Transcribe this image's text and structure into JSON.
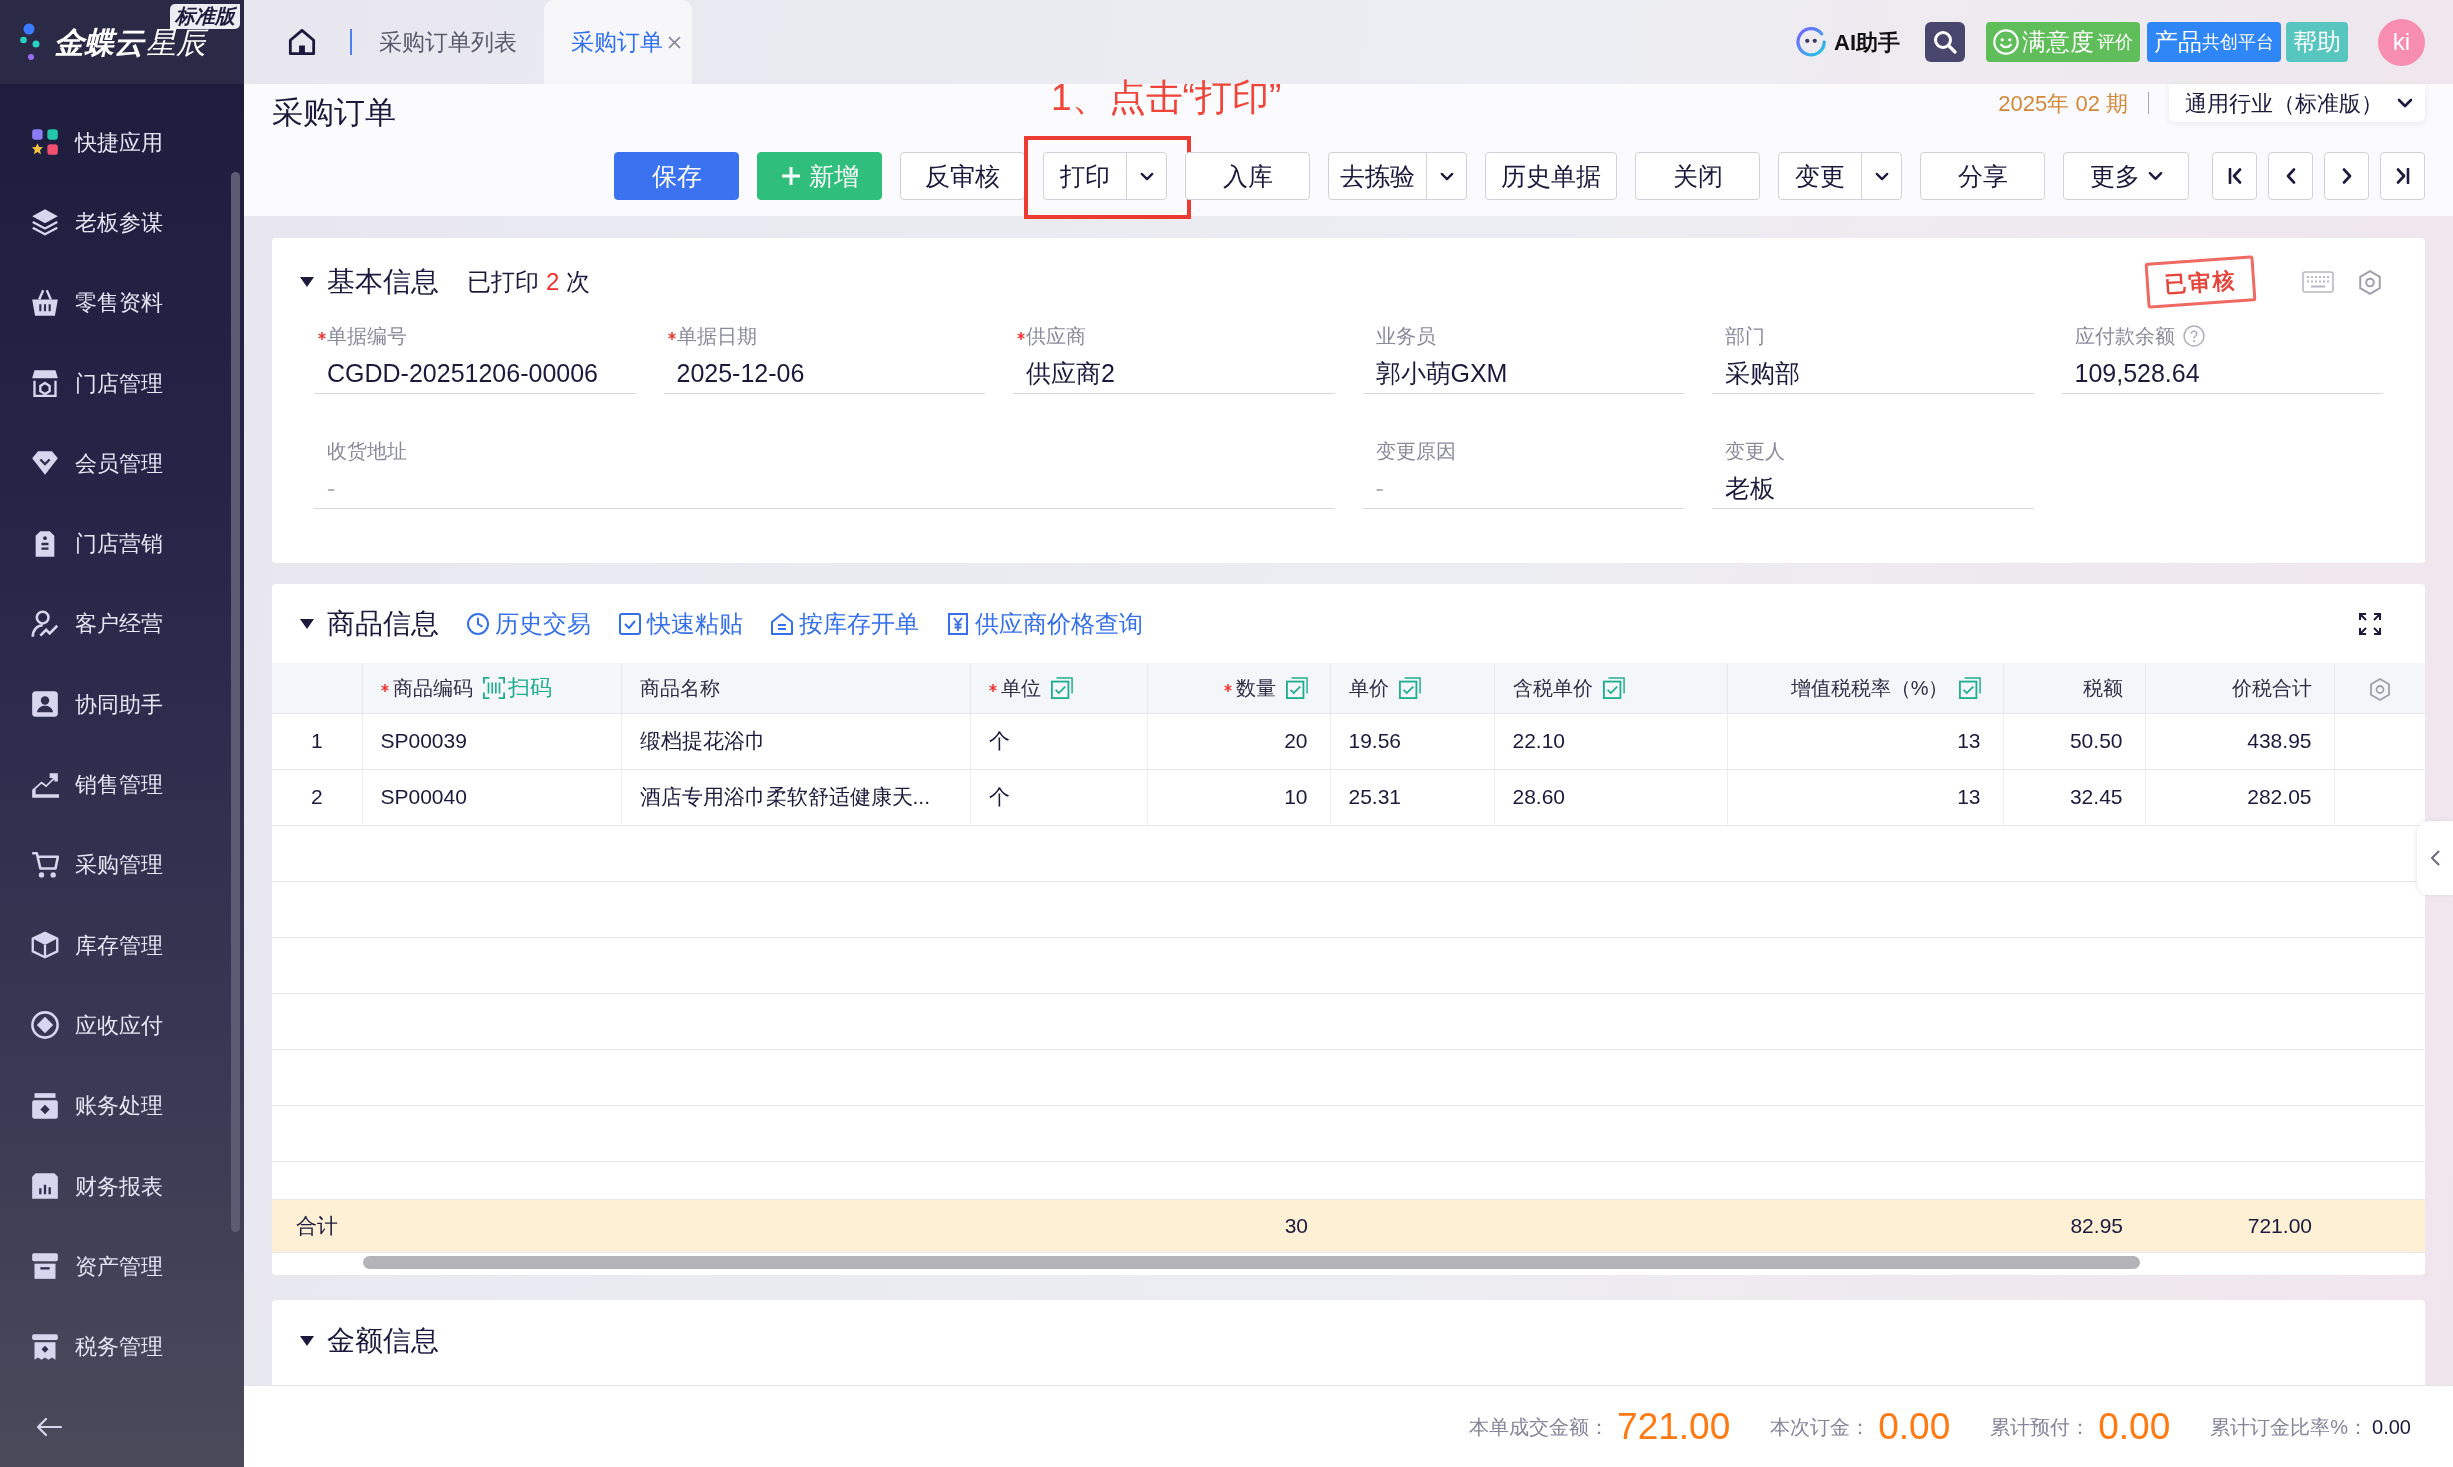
{
  "sidebar": {
    "logo": {
      "brand": "金蝶云",
      "product": "星辰",
      "edition": "标准版"
    },
    "items": [
      {
        "label": "快捷应用"
      },
      {
        "label": "老板参谋"
      },
      {
        "label": "零售资料"
      },
      {
        "label": "门店管理"
      },
      {
        "label": "会员管理"
      },
      {
        "label": "门店营销"
      },
      {
        "label": "客户经营"
      },
      {
        "label": "协同助手"
      },
      {
        "label": "销售管理"
      },
      {
        "label": "采购管理"
      },
      {
        "label": "库存管理"
      },
      {
        "label": "应收应付"
      },
      {
        "label": "账务处理"
      },
      {
        "label": "财务报表"
      },
      {
        "label": "资产管理"
      },
      {
        "label": "税务管理"
      }
    ]
  },
  "top_bar": {
    "tabs": [
      {
        "label": "采购订单列表",
        "selected": false,
        "closable": false
      },
      {
        "label": "采购订单",
        "selected": true,
        "closable": true
      }
    ],
    "ai_assistant": "AI助手",
    "satisfaction": {
      "label": "满意度",
      "suffix": "评价"
    },
    "co_creation": {
      "label": "产品",
      "suffix": "共创平台"
    },
    "help": "帮助",
    "avatar": "ki"
  },
  "page_header": {
    "title": "采购订单",
    "annotation": "1、点击“打印”",
    "period": "2025年 02 期",
    "industry": "通用行业（标准版）",
    "toolbar": [
      {
        "label": "保存",
        "kind": "primary",
        "highlighted": false
      },
      {
        "label": "新增",
        "kind": "add",
        "highlighted": false
      },
      {
        "label": "反审核",
        "kind": "plain",
        "highlighted": false
      },
      {
        "label": "打印",
        "kind": "split",
        "highlighted": true
      },
      {
        "label": "入库",
        "kind": "plain",
        "highlighted": false
      },
      {
        "label": "去拣验",
        "kind": "split",
        "highlighted": false
      },
      {
        "label": "历史单据",
        "kind": "plain",
        "highlighted": false
      },
      {
        "label": "关闭",
        "kind": "plain",
        "highlighted": false
      },
      {
        "label": "变更",
        "kind": "split",
        "highlighted": false
      },
      {
        "label": "分享",
        "kind": "plain",
        "highlighted": false
      },
      {
        "label": "更多",
        "kind": "menu",
        "highlighted": false
      }
    ],
    "pager": [
      {
        "kind": "first"
      },
      {
        "kind": "previous"
      },
      {
        "kind": "next"
      },
      {
        "kind": "last"
      }
    ]
  },
  "basic_info": {
    "title": "基本信息",
    "expanded": true,
    "print_status": {
      "prefix": "已打印",
      "count": "2",
      "suffix": "次"
    },
    "stamp": "已审核",
    "fields": [
      {
        "label": "单据编号",
        "kind": "normal",
        "required": true,
        "help": false,
        "value": "CGDD-20251206-00006"
      },
      {
        "label": "单据日期",
        "kind": "normal",
        "required": true,
        "help": false,
        "value": "2025-12-06"
      },
      {
        "label": "供应商",
        "kind": "normal",
        "required": true,
        "help": false,
        "value": "供应商2"
      },
      {
        "label": "业务员",
        "kind": "normal",
        "required": false,
        "help": false,
        "value": "郭小萌GXM"
      },
      {
        "label": "部门",
        "kind": "normal",
        "required": false,
        "help": false,
        "value": "采购部"
      },
      {
        "label": "应付款余额",
        "kind": "normal",
        "required": false,
        "help": true,
        "value": "109,528.64"
      },
      {
        "label": "收货地址",
        "kind": "wide",
        "required": false,
        "help": false,
        "placeholder": "-"
      },
      {
        "label": "变更原因",
        "kind": "normal",
        "required": false,
        "help": false,
        "placeholder": "-"
      },
      {
        "label": "变更人",
        "kind": "normal",
        "required": false,
        "help": false,
        "value": "老板"
      }
    ]
  },
  "products": {
    "title": "商品信息",
    "expanded": true,
    "actions": [
      {
        "label": "历史交易",
        "kind": "history"
      },
      {
        "label": "快速粘贴",
        "kind": "paste"
      },
      {
        "label": "按库存开单",
        "kind": "stock"
      },
      {
        "label": "供应商价格查询",
        "kind": "price"
      }
    ],
    "table": {
      "columns": [
        {
          "label": "商品编码",
          "kind": "code",
          "required": true,
          "batch_edit": false,
          "scan": "扫码"
        },
        {
          "label": "商品名称",
          "kind": "name",
          "required": false,
          "batch_edit": false
        },
        {
          "label": "单位",
          "kind": "unit",
          "required": true,
          "batch_edit": true
        },
        {
          "label": "数量",
          "kind": "quantity",
          "required": true,
          "batch_edit": true
        },
        {
          "label": "单价",
          "kind": "price",
          "required": false,
          "batch_edit": true
        },
        {
          "label": "含税单价",
          "kind": "tax_price",
          "required": false,
          "batch_edit": true
        },
        {
          "label": "增值税税率（%）",
          "kind": "tax_rate",
          "required": false,
          "batch_edit": true
        },
        {
          "label": "税额",
          "kind": "tax",
          "required": false,
          "batch_edit": false
        },
        {
          "label": "价税合计",
          "kind": "amount",
          "required": false,
          "batch_edit": false
        }
      ],
      "rows": [
        {
          "index": "1",
          "cells": [
            "SP00039",
            "缎档提花浴巾",
            "个",
            "20",
            "19.56",
            "22.10",
            "13",
            "50.50",
            "438.95"
          ]
        },
        {
          "index": "2",
          "cells": [
            "SP00040",
            "酒店专用浴巾柔软舒适健康天...",
            "个",
            "10",
            "25.31",
            "28.60",
            "13",
            "32.45",
            "282.05"
          ]
        }
      ],
      "totals": {
        "label": "合计",
        "quantity": "30",
        "tax": "82.95",
        "amount": "721.00"
      }
    }
  },
  "amount_info": {
    "title": "金额信息",
    "expanded": true
  },
  "summary": [
    {
      "label": "本单成交金额：",
      "value": "721.00",
      "kind": "highlight"
    },
    {
      "label": "本次订金：",
      "value": "0.00",
      "kind": "highlight"
    },
    {
      "label": "累计预付：",
      "value": "0.00",
      "kind": "highlight"
    },
    {
      "label": "累计订金比率%：",
      "value": "0.00",
      "kind": "plain"
    }
  ]
}
